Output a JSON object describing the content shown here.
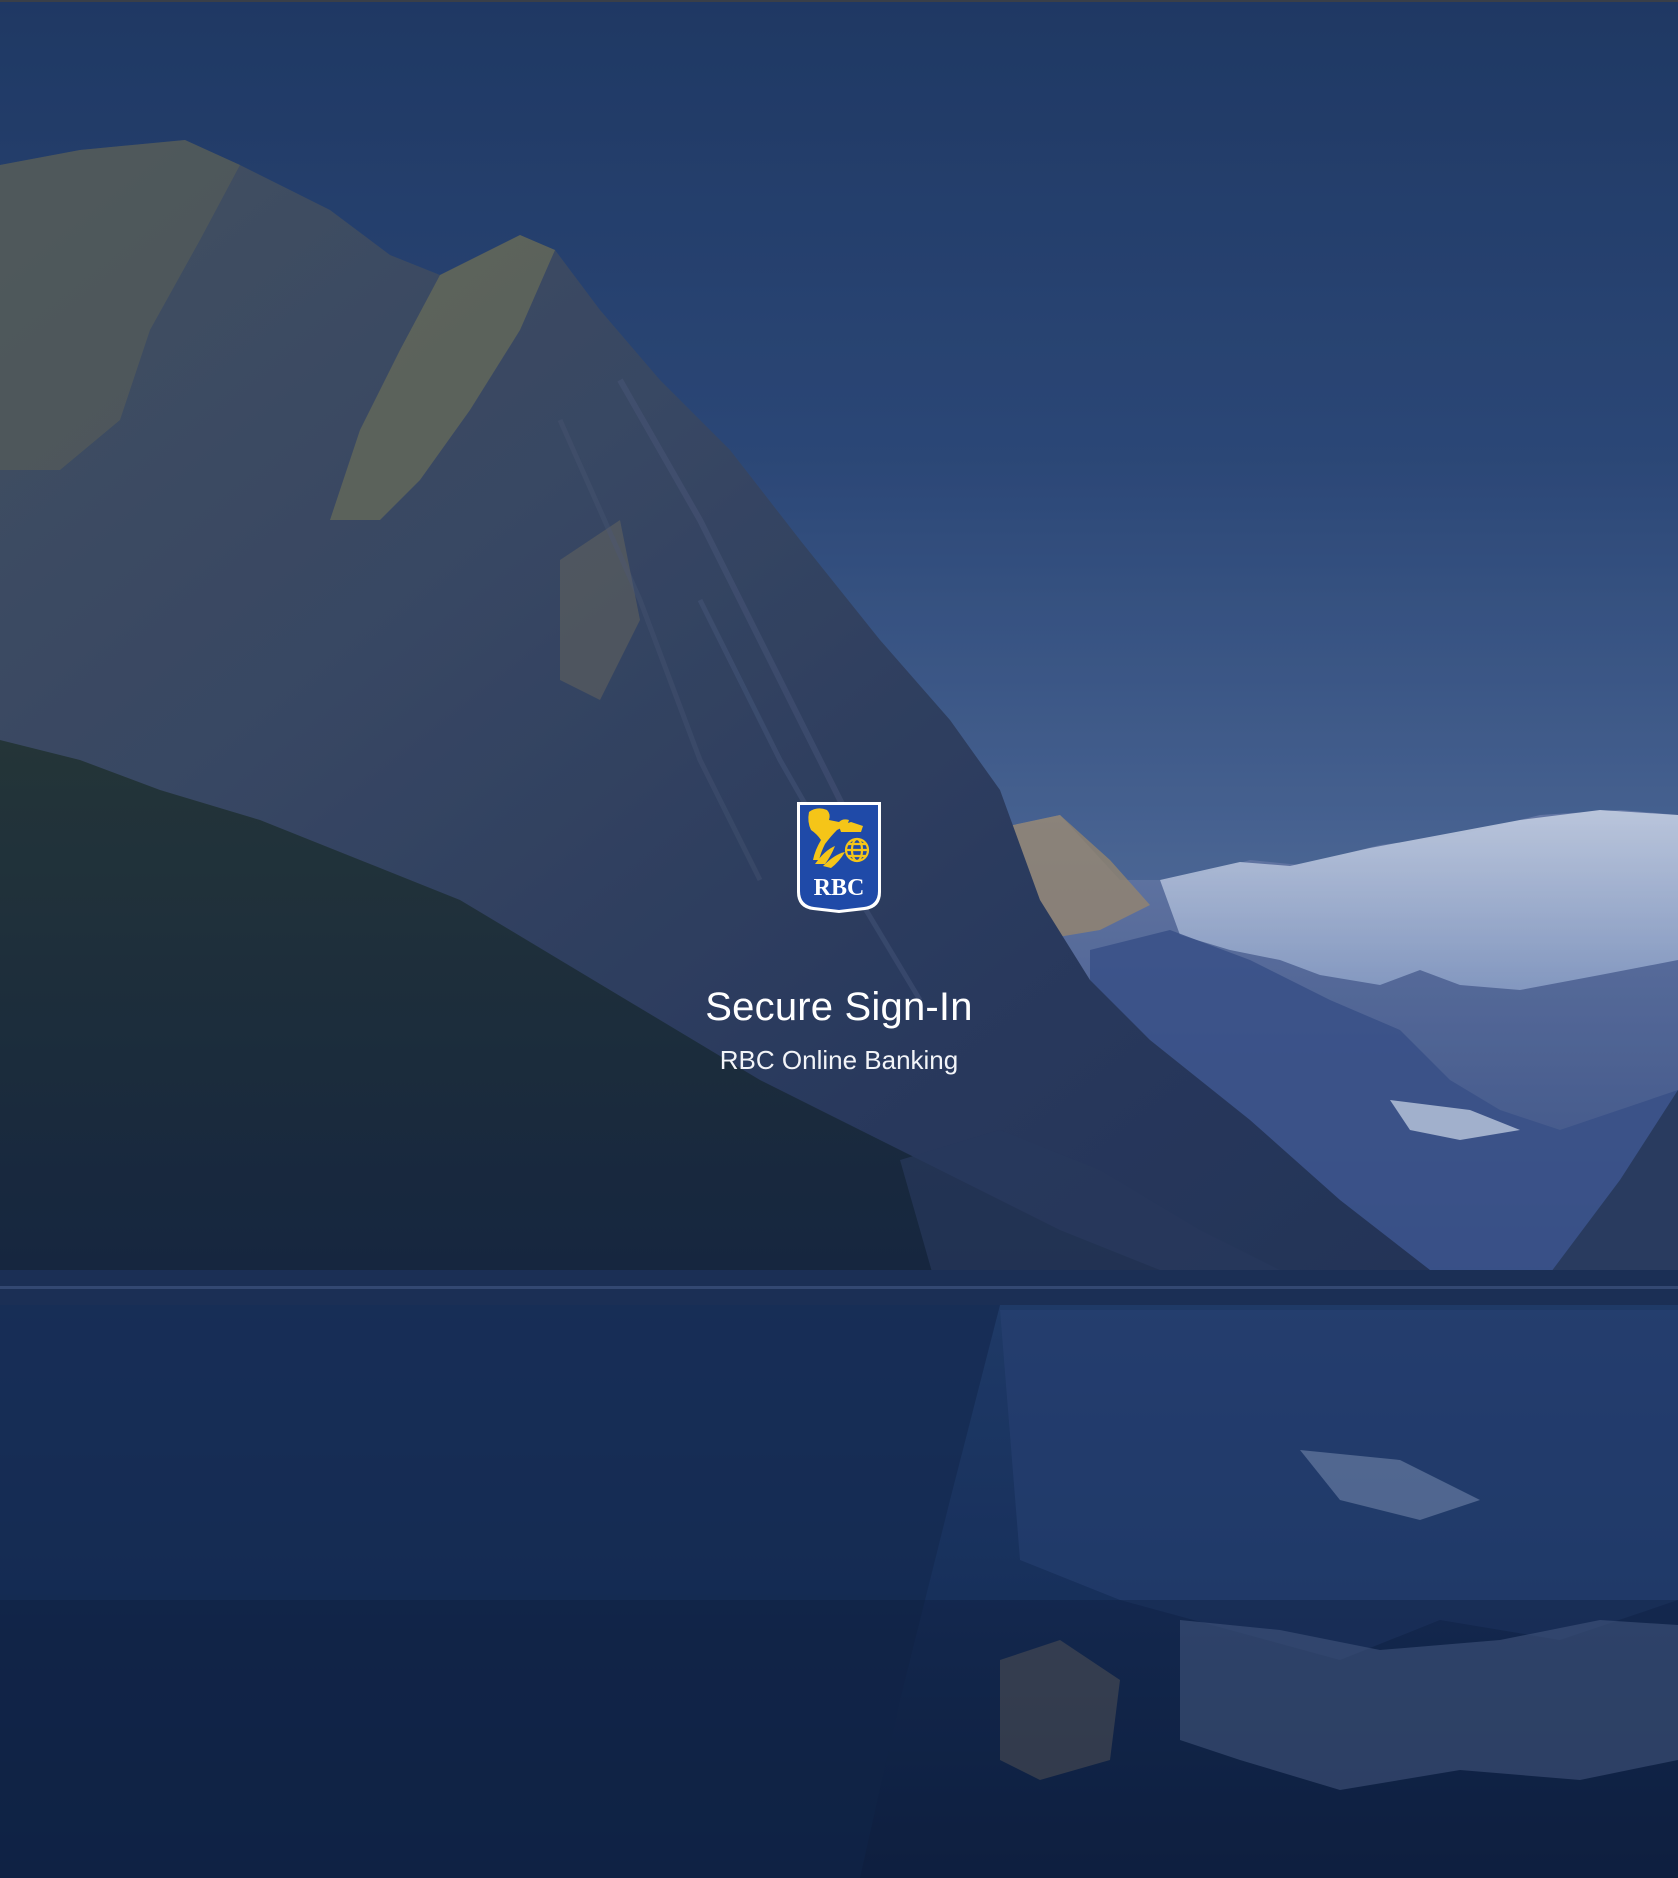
{
  "page": {
    "title": "Secure Sign-In",
    "subtitle": "RBC Online Banking"
  },
  "logo": {
    "name": "rbc-shield-logo",
    "text": "RBC",
    "colors": {
      "shield": "#1f4aa8",
      "border": "#ffffff",
      "lion": "#f5c518"
    }
  },
  "background": {
    "description_icon": "mountain-lake-background",
    "colors": {
      "sky_top": "#223d66",
      "sky_bottom": "#5d7aa8",
      "water": "#13284d"
    }
  }
}
